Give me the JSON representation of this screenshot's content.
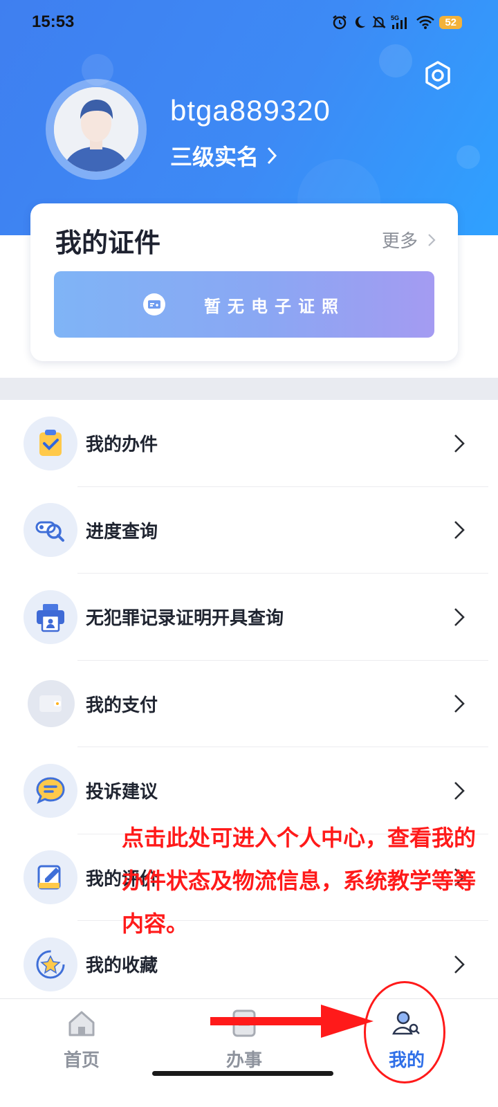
{
  "status_bar": {
    "time": "15:53",
    "battery": "52",
    "network": "5G"
  },
  "profile": {
    "username": "btga889320",
    "realname_level": "三级实名"
  },
  "certificates": {
    "title": "我的证件",
    "more": "更多",
    "empty_text": "暂无电子证照"
  },
  "menu": {
    "items": [
      {
        "label": "我的办件",
        "icon": "clipboard-check-icon"
      },
      {
        "label": "进度查询",
        "icon": "magnifier-search-icon"
      },
      {
        "label": "无犯罪记录证明开具查询",
        "icon": "printer-id-icon"
      },
      {
        "label": "我的支付",
        "icon": "wallet-icon"
      },
      {
        "label": "投诉建议",
        "icon": "chat-bubble-icon"
      },
      {
        "label": "我的评价",
        "icon": "edit-note-icon"
      },
      {
        "label": "我的收藏",
        "icon": "star-icon"
      }
    ]
  },
  "annotation": {
    "text": "点击此处可进入个人中心，查看我的办件状态及物流信息，系统教学等等内容。",
    "color": "#ff1a1a"
  },
  "tabbar": {
    "tabs": [
      {
        "label": "首页",
        "icon": "home-icon",
        "active": false
      },
      {
        "label": "办事",
        "icon": "document-icon",
        "active": false
      },
      {
        "label": "我的",
        "icon": "profile-search-icon",
        "active": true
      }
    ]
  },
  "colors": {
    "primary": "#3d8af5",
    "accent_active": "#2f6fe8",
    "annotation_red": "#ff1a1a"
  }
}
